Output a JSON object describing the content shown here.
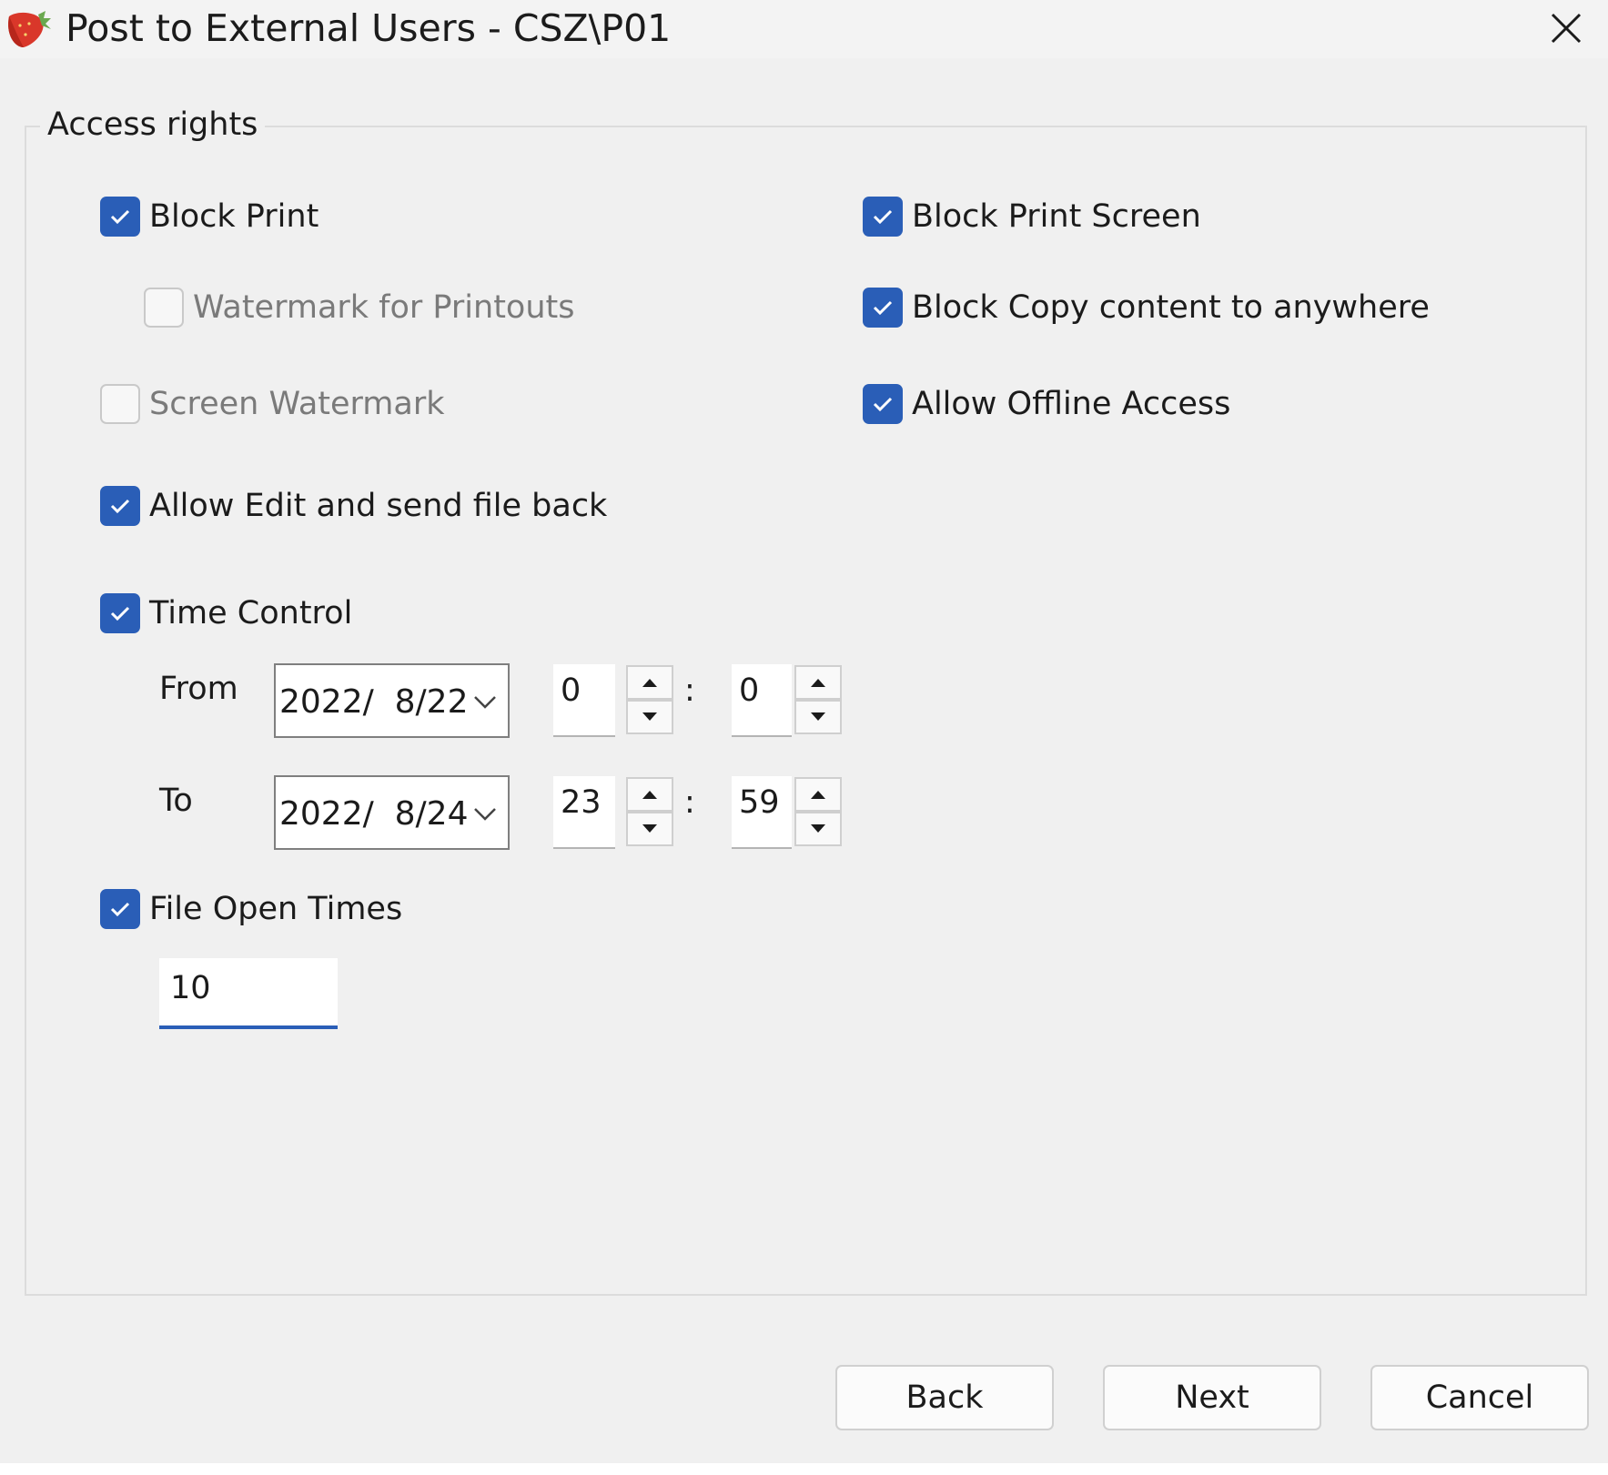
{
  "window": {
    "title": "Post to External Users - CSZ\\P01",
    "app_icon": "strawberry-app-icon",
    "close_icon": "close-x-icon"
  },
  "access_rights": {
    "legend": "Access rights",
    "block_print": {
      "label": "Block Print",
      "checked": true
    },
    "watermark_for_printouts": {
      "label": "Watermark for Printouts",
      "checked": false,
      "enabled": false
    },
    "screen_watermark": {
      "label": "Screen Watermark",
      "checked": false,
      "enabled": false
    },
    "allow_edit": {
      "label": "Allow Edit and send file back",
      "checked": true
    },
    "block_print_screen": {
      "label": "Block Print Screen",
      "checked": true
    },
    "block_copy": {
      "label": "Block Copy content to anywhere",
      "checked": true
    },
    "allow_offline": {
      "label": "Allow Offline Access",
      "checked": true
    },
    "time_control": {
      "label": "Time Control",
      "checked": true,
      "from": {
        "label": "From",
        "date": "2022/  8/22",
        "hour": "0",
        "minute": "0"
      },
      "to": {
        "label": "To",
        "date": "2022/  8/24",
        "hour": "23",
        "minute": "59"
      },
      "separator": ":"
    },
    "file_open_times": {
      "label": "File Open Times",
      "checked": true,
      "value": "10"
    }
  },
  "buttons": {
    "back": "Back",
    "next": "Next",
    "cancel": "Cancel"
  },
  "colors": {
    "accent": "#2a5eb7",
    "window_bg": "#f0f0f0"
  }
}
